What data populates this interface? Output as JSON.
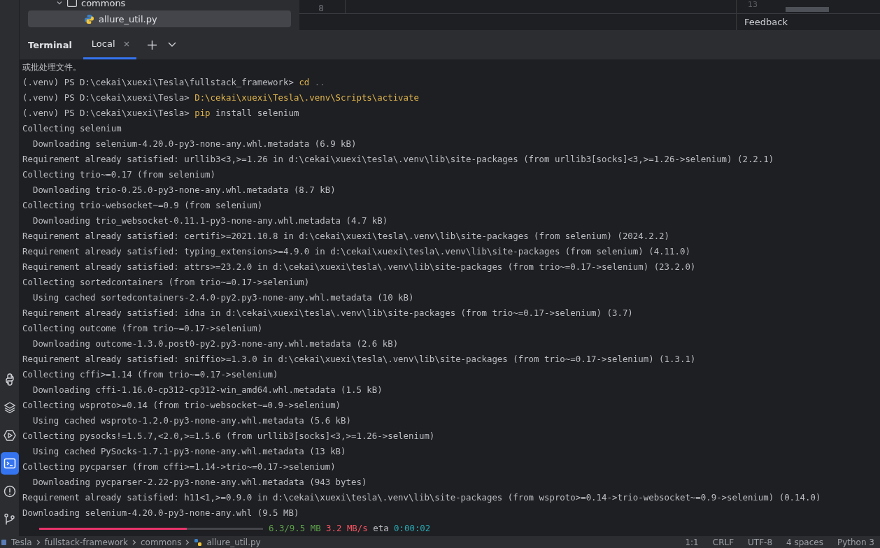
{
  "project_tree": {
    "items": [
      {
        "label": "commons",
        "expanded": true,
        "children": [
          {
            "label": "allure_util.py",
            "selected": true
          }
        ]
      }
    ]
  },
  "editor": {
    "line_numbers": [
      "8"
    ]
  },
  "side_panel": {
    "line_numbers": [
      "13"
    ],
    "link": "Feedback"
  },
  "tool_window": {
    "title": "Terminal",
    "tabs": [
      {
        "label": "Local",
        "selected": true
      }
    ]
  },
  "terminal": {
    "lines": [
      {
        "segments": [
          {
            "kind": "plain",
            "text": "或批处理文件。"
          }
        ]
      },
      {
        "segments": [
          {
            "kind": "plain",
            "text": "(.venv) PS D:\\cekai\\xuexi\\Tesla\\fullstack_framework> "
          },
          {
            "kind": "command",
            "text": "cd"
          },
          {
            "kind": "dim",
            "text": " .."
          }
        ]
      },
      {
        "segments": [
          {
            "kind": "plain",
            "text": "(.venv) PS D:\\cekai\\xuexi\\Tesla> "
          },
          {
            "kind": "command",
            "text": "D:\\cekai\\xuexi\\Tesla\\.venv\\Scripts\\activate"
          }
        ]
      },
      {
        "segments": [
          {
            "kind": "plain",
            "text": "(.venv) PS D:\\cekai\\xuexi\\Tesla> "
          },
          {
            "kind": "command",
            "text": "pip"
          },
          {
            "kind": "plain",
            "text": " install selenium"
          }
        ]
      },
      {
        "segments": [
          {
            "kind": "plain",
            "text": "Collecting selenium"
          }
        ]
      },
      {
        "segments": [
          {
            "kind": "plain",
            "text": "  Downloading selenium-4.20.0-py3-none-any.whl.metadata (6.9 kB)"
          }
        ]
      },
      {
        "segments": [
          {
            "kind": "plain",
            "text": "Requirement already satisfied: urllib3<3,>=1.26 in d:\\cekai\\xuexi\\tesla\\.venv\\lib\\site-packages (from urllib3[socks]<3,>=1.26->selenium) (2.2.1)"
          }
        ]
      },
      {
        "segments": [
          {
            "kind": "plain",
            "text": "Collecting trio~=0.17 (from selenium)"
          }
        ]
      },
      {
        "segments": [
          {
            "kind": "plain",
            "text": "  Downloading trio-0.25.0-py3-none-any.whl.metadata (8.7 kB)"
          }
        ]
      },
      {
        "segments": [
          {
            "kind": "plain",
            "text": "Collecting trio-websocket~=0.9 (from selenium)"
          }
        ]
      },
      {
        "segments": [
          {
            "kind": "plain",
            "text": "  Downloading trio_websocket-0.11.1-py3-none-any.whl.metadata (4.7 kB)"
          }
        ]
      },
      {
        "segments": [
          {
            "kind": "plain",
            "text": "Requirement already satisfied: certifi>=2021.10.8 in d:\\cekai\\xuexi\\tesla\\.venv\\lib\\site-packages (from selenium) (2024.2.2)"
          }
        ]
      },
      {
        "segments": [
          {
            "kind": "plain",
            "text": "Requirement already satisfied: typing_extensions>=4.9.0 in d:\\cekai\\xuexi\\tesla\\.venv\\lib\\site-packages (from selenium) (4.11.0)"
          }
        ]
      },
      {
        "segments": [
          {
            "kind": "plain",
            "text": "Requirement already satisfied: attrs>=23.2.0 in d:\\cekai\\xuexi\\tesla\\.venv\\lib\\site-packages (from trio~=0.17->selenium) (23.2.0)"
          }
        ]
      },
      {
        "segments": [
          {
            "kind": "plain",
            "text": "Collecting sortedcontainers (from trio~=0.17->selenium)"
          }
        ]
      },
      {
        "segments": [
          {
            "kind": "plain",
            "text": "  Using cached sortedcontainers-2.4.0-py2.py3-none-any.whl.metadata (10 kB)"
          }
        ]
      },
      {
        "segments": [
          {
            "kind": "plain",
            "text": "Requirement already satisfied: idna in d:\\cekai\\xuexi\\tesla\\.venv\\lib\\site-packages (from trio~=0.17->selenium) (3.7)"
          }
        ]
      },
      {
        "segments": [
          {
            "kind": "plain",
            "text": "Collecting outcome (from trio~=0.17->selenium)"
          }
        ]
      },
      {
        "segments": [
          {
            "kind": "plain",
            "text": "  Downloading outcome-1.3.0.post0-py2.py3-none-any.whl.metadata (2.6 kB)"
          }
        ]
      },
      {
        "segments": [
          {
            "kind": "plain",
            "text": "Requirement already satisfied: sniffio>=1.3.0 in d:\\cekai\\xuexi\\tesla\\.venv\\lib\\site-packages (from trio~=0.17->selenium) (1.3.1)"
          }
        ]
      },
      {
        "segments": [
          {
            "kind": "plain",
            "text": "Collecting cffi>=1.14 (from trio~=0.17->selenium)"
          }
        ]
      },
      {
        "segments": [
          {
            "kind": "plain",
            "text": "  Downloading cffi-1.16.0-cp312-cp312-win_amd64.whl.metadata (1.5 kB)"
          }
        ]
      },
      {
        "segments": [
          {
            "kind": "plain",
            "text": "Collecting wsproto>=0.14 (from trio-websocket~=0.9->selenium)"
          }
        ]
      },
      {
        "segments": [
          {
            "kind": "plain",
            "text": "  Using cached wsproto-1.2.0-py3-none-any.whl.metadata (5.6 kB)"
          }
        ]
      },
      {
        "segments": [
          {
            "kind": "plain",
            "text": "Collecting pysocks!=1.5.7,<2.0,>=1.5.6 (from urllib3[socks]<3,>=1.26->selenium)"
          }
        ]
      },
      {
        "segments": [
          {
            "kind": "plain",
            "text": "  Using cached PySocks-1.7.1-py3-none-any.whl.metadata (13 kB)"
          }
        ]
      },
      {
        "segments": [
          {
            "kind": "plain",
            "text": "Collecting pycparser (from cffi>=1.14->trio~=0.17->selenium)"
          }
        ]
      },
      {
        "segments": [
          {
            "kind": "plain",
            "text": "  Downloading pycparser-2.22-py3-none-any.whl.metadata (943 bytes)"
          }
        ]
      },
      {
        "segments": [
          {
            "kind": "plain",
            "text": "Requirement already satisfied: h11<1,>=0.9.0 in d:\\cekai\\xuexi\\tesla\\.venv\\lib\\site-packages (from wsproto>=0.14->trio-websocket~=0.9->selenium) (0.14.0)"
          }
        ]
      },
      {
        "segments": [
          {
            "kind": "plain",
            "text": "Downloading selenium-4.20.0-py3-none-any.whl (9.5 MB)"
          }
        ]
      }
    ],
    "progress": {
      "level": 0.66,
      "segments": [
        {
          "kind": "size",
          "text": "6.3/9.5 MB"
        },
        {
          "kind": "speed",
          "text": " 3.2 MB/s"
        },
        {
          "kind": "plain",
          "text": " eta "
        },
        {
          "kind": "eta",
          "text": "0:00:02"
        }
      ]
    }
  },
  "left_toolbar": {
    "items": [
      {
        "kind": "python",
        "selected": false
      },
      {
        "kind": "layers",
        "selected": false
      },
      {
        "kind": "run",
        "selected": false
      },
      {
        "kind": "terminal",
        "selected": true
      },
      {
        "kind": "problems",
        "selected": false
      },
      {
        "kind": "git",
        "selected": false
      }
    ]
  },
  "status_bar": {
    "breadcrumbs": [
      "Tesla",
      "fullstack-framework",
      "commons",
      "allure_util.py"
    ],
    "items": [
      "1:1",
      "CRLF",
      "UTF-8",
      "4 spaces",
      "Python 3"
    ]
  }
}
